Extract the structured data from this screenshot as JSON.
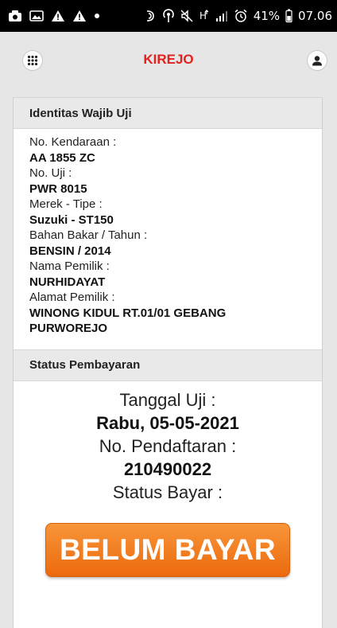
{
  "statusbar": {
    "battery_percent": "41%",
    "time": "07.06"
  },
  "header": {
    "title": "KIREJO"
  },
  "identitas": {
    "heading": "Identitas Wajib Uji",
    "fields": [
      {
        "label": "No. Kendaraan :",
        "value": "AA 1855 ZC"
      },
      {
        "label": "No. Uji :",
        "value": "PWR 8015"
      },
      {
        "label": "Merek - Tipe :",
        "value": "Suzuki - ST150"
      },
      {
        "label": "Bahan Bakar / Tahun :",
        "value": "BENSIN / 2014"
      },
      {
        "label": "Nama Pemilik :",
        "value": "NURHIDAYAT"
      },
      {
        "label": "Alamat Pemilik :",
        "value": "WINONG KIDUL RT.01/01 GEBANG PURWOREJO"
      }
    ]
  },
  "status": {
    "heading": "Status Pembayaran",
    "tanggal_label": "Tanggal Uji :",
    "tanggal_value": "Rabu, 05-05-2021",
    "pendaftaran_label": "No. Pendaftaran :",
    "pendaftaran_value": "210490022",
    "bayar_label": "Status Bayar :",
    "bayar_button": "BELUM BAYAR"
  },
  "colors": {
    "title_red": "#e3211d",
    "button_orange": "#ec6a0d"
  }
}
